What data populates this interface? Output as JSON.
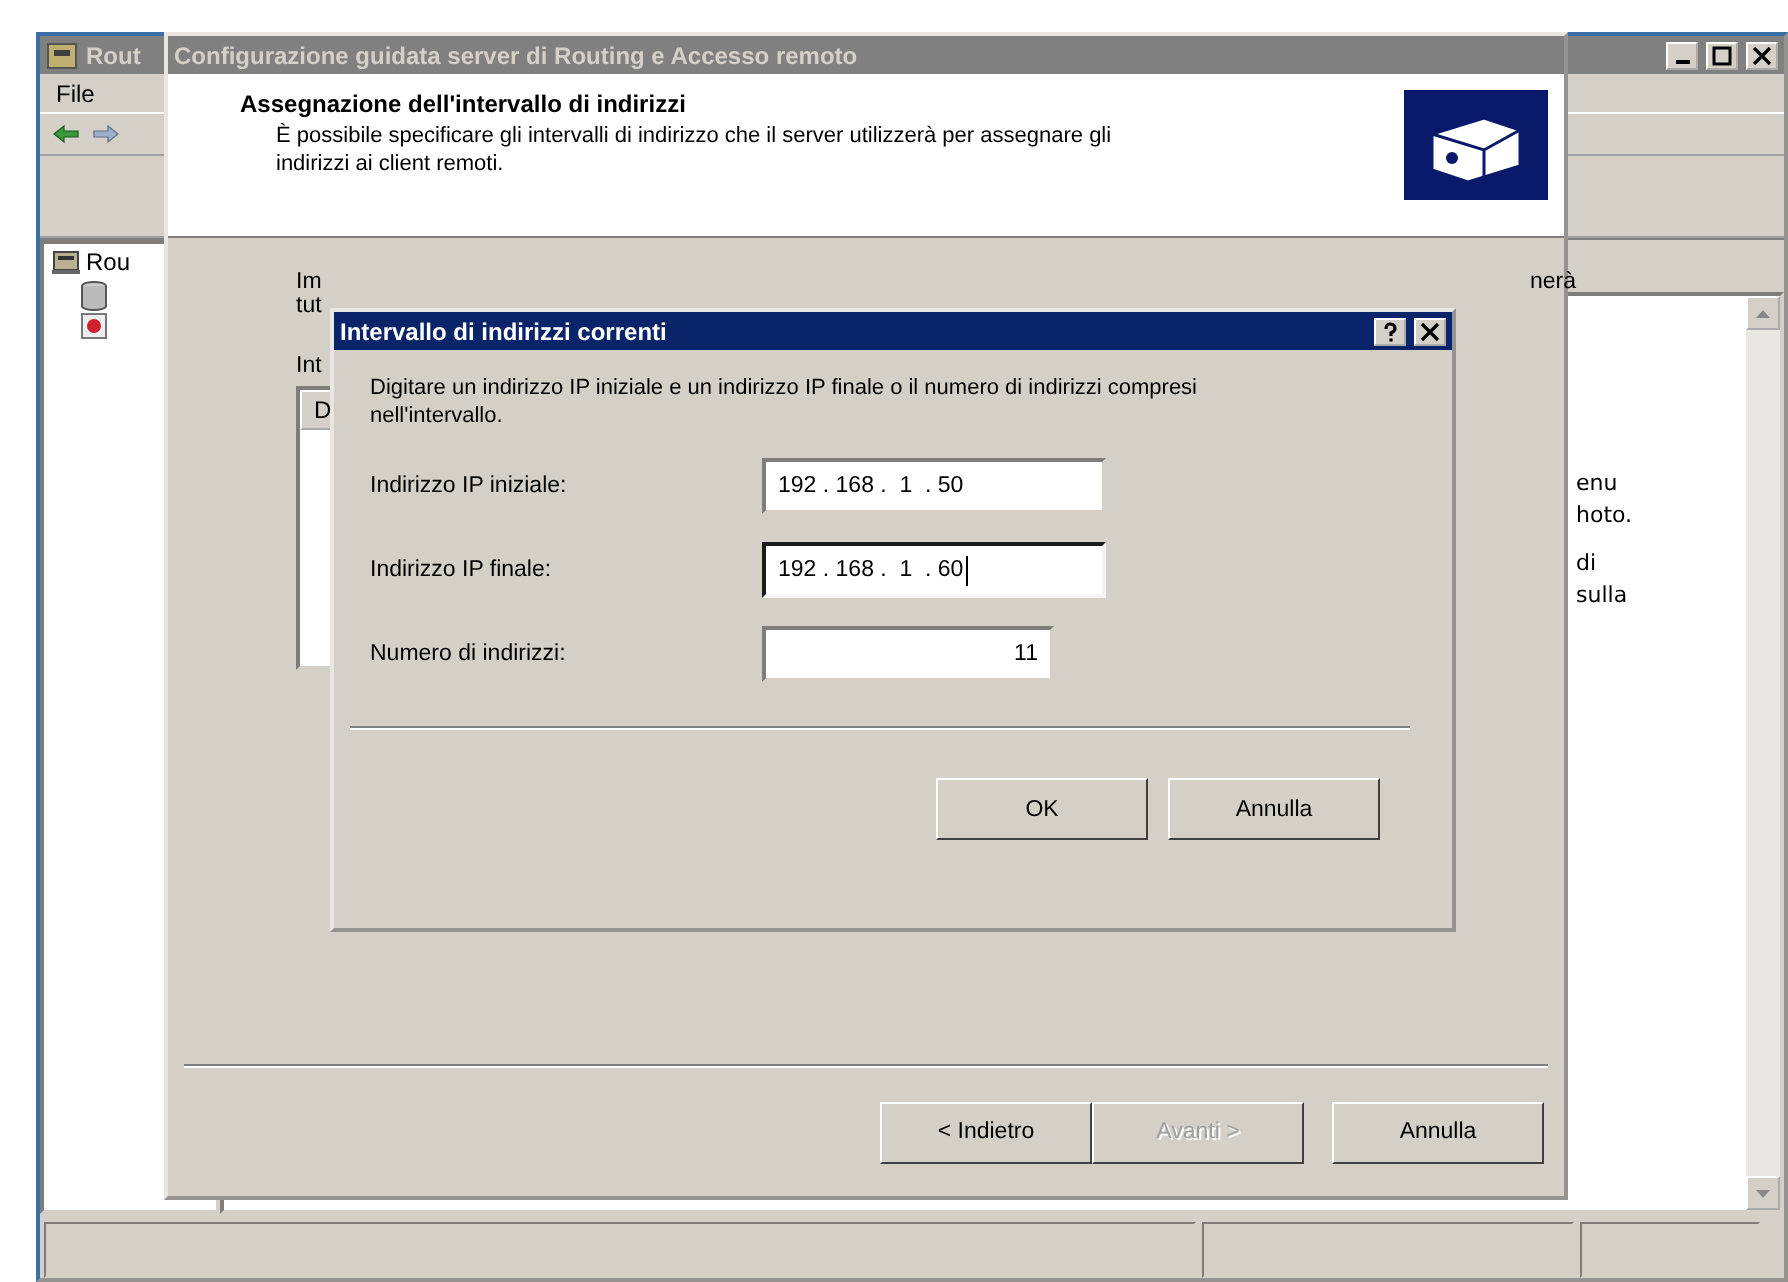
{
  "main_window": {
    "title": "Rout",
    "active": false,
    "menu": [
      "File"
    ],
    "tree": {
      "root": "Rou"
    },
    "right_pane_text": [
      "enu",
      "hoto.",
      "di",
      "sulla"
    ]
  },
  "wizard": {
    "title": "Configurazione guidata server di Routing e Accesso remoto",
    "active": false,
    "heading": "Assegnazione dell'intervallo di indirizzi",
    "subtitle": "È possibile specificare gli intervalli di indirizzo che il server utilizzerà per assegnare gli indirizzi ai client remoti.",
    "intro_start": "Im",
    "intro_end": "nerà",
    "intro_line2": "tut",
    "list_label": "Int",
    "list_header": "D",
    "buttons": [
      {
        "label": "< Indietro",
        "disabled": false
      },
      {
        "label": "Avanti >",
        "disabled": true
      },
      {
        "label": "Annulla",
        "disabled": false
      }
    ]
  },
  "dialog": {
    "title": "Intervallo di indirizzi correnti",
    "active": true,
    "description": "Digitare un indirizzo IP iniziale e un indirizzo IP finale o il numero di indirizzi compresi nell'intervallo.",
    "fields": [
      {
        "kind": "ip",
        "label": "Indirizzo IP iniziale:",
        "value": "192 . 168 .  1  . 50",
        "focused": false
      },
      {
        "kind": "ip",
        "label": "Indirizzo IP finale:",
        "value": "192 . 168 .  1  . 60",
        "focused": true
      },
      {
        "kind": "number",
        "label": "Numero di indirizzi:",
        "value": "11",
        "focused": false
      }
    ],
    "buttons": [
      "OK",
      "Annulla"
    ]
  }
}
